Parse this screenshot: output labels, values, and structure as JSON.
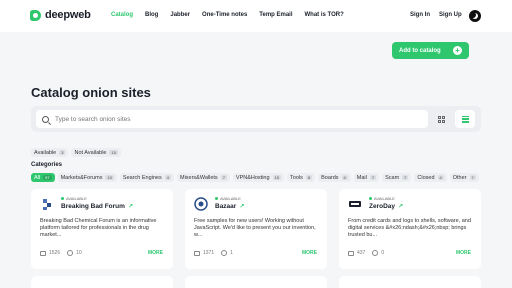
{
  "brand": {
    "name": "deepweb"
  },
  "nav": {
    "items": [
      {
        "label": "Catalog",
        "active": true
      },
      {
        "label": "Blog",
        "active": false
      },
      {
        "label": "Jabber",
        "active": false
      },
      {
        "label": "One-Time notes",
        "active": false
      },
      {
        "label": "Temp Email",
        "active": false
      },
      {
        "label": "What is TOR?",
        "active": false
      }
    ],
    "sign_in": "Sign In",
    "sign_up": "Sign Up"
  },
  "add_button": {
    "label": "Add to catalog"
  },
  "page_title": "Catalog onion sites",
  "search": {
    "placeholder": "Type to search onion sites"
  },
  "availability": [
    {
      "label": "Available",
      "count": "3"
    },
    {
      "label": "Not Available",
      "count": "15"
    }
  ],
  "categories_label": "Categories",
  "categories": [
    {
      "label": "All",
      "count": "97",
      "active": true
    },
    {
      "label": "Markets&Forums",
      "count": "15"
    },
    {
      "label": "Search Engines",
      "count": "4"
    },
    {
      "label": "Mixers&Wallets",
      "count": "7"
    },
    {
      "label": "VPN&Hosting",
      "count": "15"
    },
    {
      "label": "Tools",
      "count": "8"
    },
    {
      "label": "Boards",
      "count": "4"
    },
    {
      "label": "Mail",
      "count": "7"
    },
    {
      "label": "Scam",
      "count": "7"
    },
    {
      "label": "Closed",
      "count": "4"
    },
    {
      "label": "Other",
      "count": "7"
    }
  ],
  "cards": [
    {
      "status": "AVAILABLE",
      "name": "Breaking Bad Forum",
      "description": "Breaking Bad Chemical Forum is an informative platform tailored for professionals in the drug market...",
      "likes": "1526",
      "comments": "10",
      "more": "MORE"
    },
    {
      "status": "AVAILABLE",
      "name": "Bazaar",
      "description": "Free samples for new users! Working without JavaScript. We'd like to present you our invention, w...",
      "likes": "1371",
      "comments": "1",
      "more": "MORE"
    },
    {
      "status": "AVAILABLE",
      "name": "ZeroDay",
      "description": "From credit cards and logs to shells, software, and digital services &#x26;ndash;&#x26;nbsp; brings trusted bu...",
      "likes": "437",
      "comments": "0",
      "more": "MORE"
    }
  ]
}
